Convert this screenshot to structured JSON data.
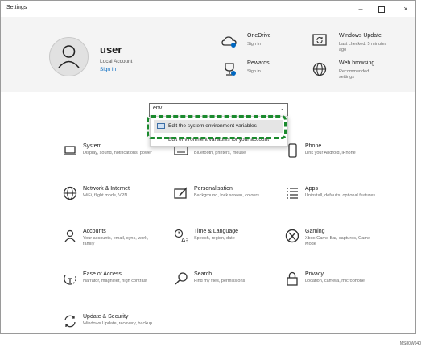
{
  "window": {
    "title": "Settings",
    "controls": {
      "minimize": "–",
      "maximize": "",
      "close": "×"
    }
  },
  "account": {
    "name": "user",
    "type": "Local Account",
    "sign_in": "Sign In"
  },
  "header_items": [
    {
      "title": "OneDrive",
      "sub": "Sign in",
      "icon": "cloud-icon"
    },
    {
      "title": "Rewards",
      "sub": "Sign in",
      "icon": "trophy-icon"
    },
    {
      "title": "Windows Update",
      "sub": "Last checked: 5 minutes ago",
      "icon": "update-icon"
    },
    {
      "title": "Web browsing",
      "sub": "Recommended settings",
      "icon": "globe-icon"
    }
  ],
  "search": {
    "value": "env"
  },
  "dropdown": {
    "item1": "Edit the system environment variables",
    "item2": "Edit environment variables for your account"
  },
  "tiles": [
    {
      "title": "System",
      "desc": "Display, sound, notifications, power",
      "icon": "laptop-icon"
    },
    {
      "title": "Devices",
      "desc": "Bluetooth, printers, mouse",
      "icon": "keyboard-icon"
    },
    {
      "title": "Phone",
      "desc": "Link your Android, iPhone",
      "icon": "phone-icon"
    },
    {
      "title": "Network & Internet",
      "desc": "WiFi, flight mode, VPN",
      "icon": "globe-icon"
    },
    {
      "title": "Personalisation",
      "desc": "Background, lock screen, colours",
      "icon": "brush-icon"
    },
    {
      "title": "Apps",
      "desc": "Uninstall, defaults, optional features",
      "icon": "apps-list-icon"
    },
    {
      "title": "Accounts",
      "desc": "Your accounts, email, sync, work, family",
      "icon": "person-icon"
    },
    {
      "title": "Time & Language",
      "desc": "Speech, region, date",
      "icon": "language-icon"
    },
    {
      "title": "Gaming",
      "desc": "Xbox Game Bar, captures, Game Mode",
      "icon": "xbox-icon"
    },
    {
      "title": "Ease of Access",
      "desc": "Narrator, magnifier, high contrast",
      "icon": "ease-of-access-icon"
    },
    {
      "title": "Search",
      "desc": "Find my files, permissions",
      "icon": "search-icon"
    },
    {
      "title": "Privacy",
      "desc": "Location, camera, microphone",
      "icon": "lock-icon"
    },
    {
      "title": "Update & Security",
      "desc": "Windows Update, recovery, backup",
      "icon": "sync-icon"
    }
  ],
  "corner_code": "MS80W040",
  "colors": {
    "accent": "#0067c0",
    "highlight": "#1a8a2d",
    "header_bg": "#f4f4f4"
  }
}
